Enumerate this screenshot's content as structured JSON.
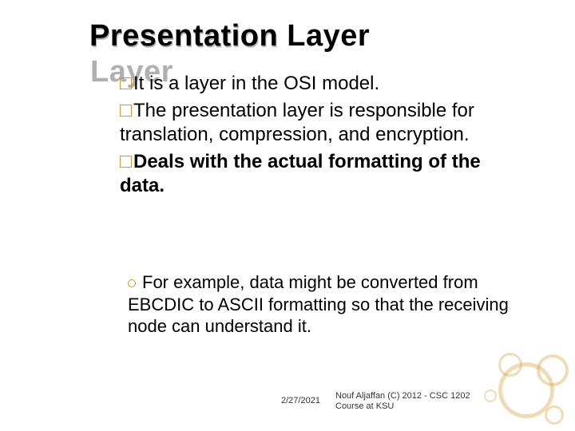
{
  "title": "Presentation Layer",
  "bullets": [
    {
      "text": "It is a layer in the OSI model.",
      "bold": false
    },
    {
      "text": "The presentation layer is responsible for translation, compression, and encryption.",
      "bold": false
    },
    {
      "text": "Deals with the actual formatting of the data.",
      "bold": true
    }
  ],
  "subbullet": "For example, data might be converted from EBCDIC to ASCII formatting so that the receiving node can understand it.",
  "footer": {
    "date": "2/27/2021",
    "credit_line1": "Nouf Aljaffan (C) 2012 - CSC 1202",
    "credit_line2": "Course at KSU"
  }
}
